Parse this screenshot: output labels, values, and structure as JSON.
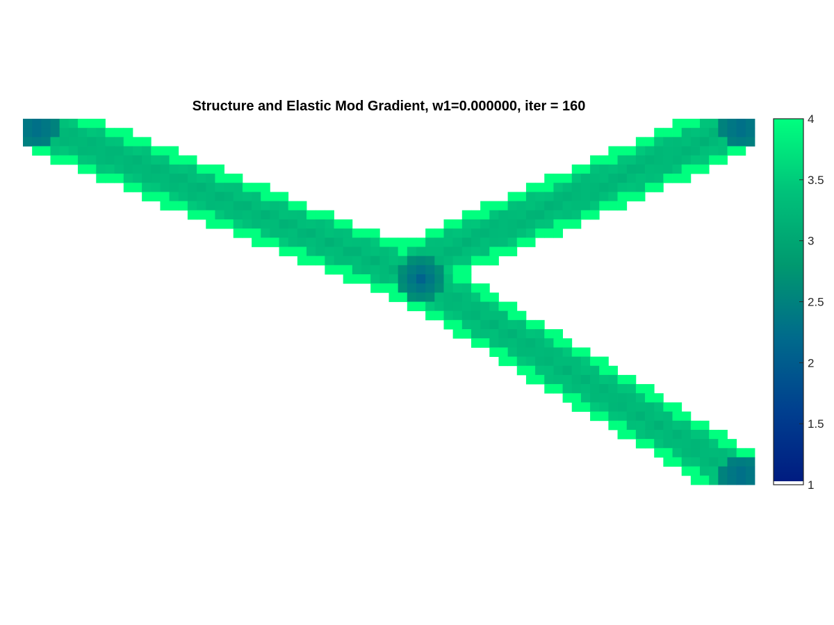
{
  "figure": {
    "title": "Structure and Elastic Mod Gradient, w1=0.000000, iter = 160"
  },
  "chart_data": {
    "type": "heatmap",
    "title": "Structure and Elastic Mod Gradient, w1=0.000000, iter = 160",
    "xlabel": "",
    "ylabel": "",
    "axes_visible": false,
    "grid": false,
    "grid_size": {
      "cols": 80,
      "rows": 40
    },
    "colormap": "winter-like (dark blue to spring green)",
    "colormap_stops": [
      "#001a80",
      "#003f8f",
      "#006a8c",
      "#00996f",
      "#00c27a",
      "#00ff7f"
    ],
    "color_scale": {
      "min": 1,
      "max": 4,
      "empty_value": 1,
      "empty_color": "#ffffff"
    },
    "colorbar": {
      "location": "right",
      "ticks": [
        1,
        1.5,
        2,
        2.5,
        3,
        3.5,
        4
      ],
      "tick_labels": [
        "1",
        "1.5",
        "2",
        "2.5",
        "3",
        "3.5",
        "4"
      ]
    },
    "structure": {
      "description_values": "elastic modulus per element; void elements are 1",
      "edge_value": 4.0,
      "core_value": 3.2,
      "corner_value": 2.2,
      "junction_value": 2.1,
      "members": [
        {
          "name": "upper-left diagonal",
          "from": [
            0,
            0
          ],
          "to": [
            42,
            17
          ],
          "half_width": 3.0
        },
        {
          "name": "upper-right diagonal",
          "from": [
            80,
            0
          ],
          "to": [
            43,
            16
          ],
          "half_width": 3.0
        },
        {
          "name": "lower-right diagonal",
          "from": [
            44,
            18
          ],
          "to": [
            80,
            40
          ],
          "half_width": 3.0
        }
      ]
    }
  }
}
